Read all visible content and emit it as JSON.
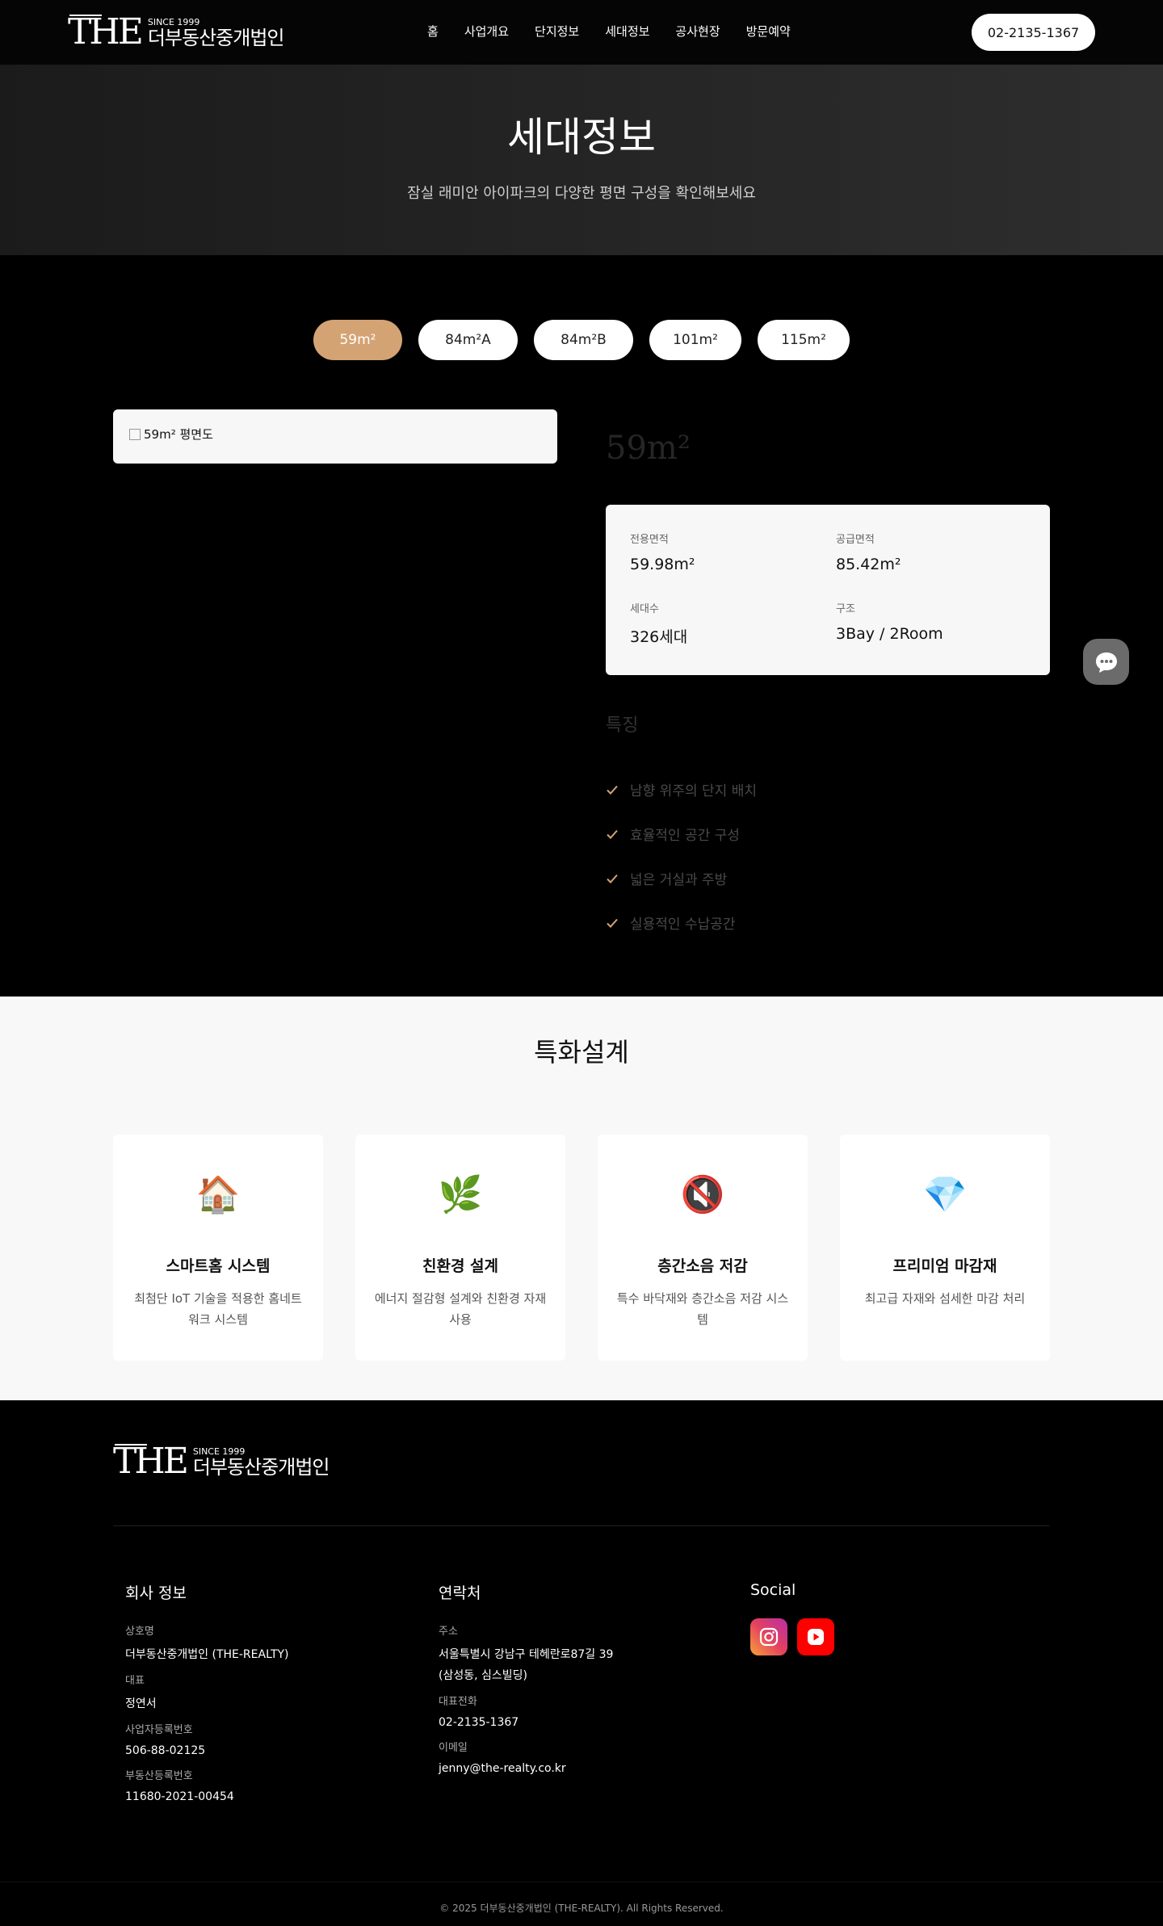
{
  "header": {
    "logo_mark": "THE",
    "logo_since": "SINCE 1999",
    "logo_name": "더부동산중개법인",
    "nav": [
      "홈",
      "사업개요",
      "단지정보",
      "세대정보",
      "공사현장",
      "방문예약"
    ],
    "phone": "02-2135-1367"
  },
  "hero": {
    "title": "세대정보",
    "subtitle": "잠실 래미안 아이파크의 다양한 평면 구성을 확인해보세요"
  },
  "types": {
    "tabs": [
      "59m²",
      "84m²A",
      "84m²B",
      "101m²",
      "115m²"
    ],
    "active_index": 0
  },
  "unit": {
    "plan_alt": "59m² 평면도",
    "title": "59m²",
    "specs": [
      {
        "label": "전용면적",
        "value": "59.98m²"
      },
      {
        "label": "공급면적",
        "value": "85.42m²"
      },
      {
        "label": "세대수",
        "value": "326세대"
      },
      {
        "label": "구조",
        "value": "3Bay / 2Room"
      }
    ],
    "features_title": "특징",
    "features": [
      "남향 위주의 단지 배치",
      "효율적인 공간 구성",
      "넓은 거실과 주방",
      "실용적인 수납공간"
    ]
  },
  "special": {
    "title": "특화설계",
    "cards": [
      {
        "emoji": "🏠",
        "title": "스마트홈 시스템",
        "desc": "최첨단 IoT 기술을 적용한 홈네트워크 시스템"
      },
      {
        "emoji": "🌿",
        "title": "친환경 설계",
        "desc": "에너지 절감형 설계와 친환경 자재 사용"
      },
      {
        "emoji": "🔇",
        "title": "층간소음 저감",
        "desc": "특수 바닥재와 층간소음 저감 시스템"
      },
      {
        "emoji": "💎",
        "title": "프리미엄 마감재",
        "desc": "최고급 자재와 섬세한 마감 처리"
      }
    ]
  },
  "footer": {
    "company_title": "회사 정보",
    "company": [
      {
        "k": "상호명",
        "v": "더부동산중개법인 (THE-REALTY)"
      },
      {
        "k": "대표",
        "v": "정연서"
      },
      {
        "k": "사업자등록번호",
        "v": "506-88-02125"
      },
      {
        "k": "부동산등록번호",
        "v": "11680-2021-00454"
      }
    ],
    "contact_title": "연락처",
    "address_label": "주소",
    "address_line1": "서울특별시 강남구 테헤란로87길 39",
    "address_line2": "(삼성동, 심스빌딩)",
    "tel_label": "대표전화",
    "tel": "02-2135-1367",
    "email_label": "이메일",
    "email": "jenny@the-realty.co.kr",
    "social_title": "Social",
    "social": [
      "instagram-icon",
      "youtube-icon"
    ],
    "copyright": "© 2025 더부동산중개법인 (THE-REALTY). All Rights Reserved."
  },
  "colors": {
    "accent": "#d4a374",
    "header_bg": "#050505",
    "section_light": "#f8f8f8"
  }
}
